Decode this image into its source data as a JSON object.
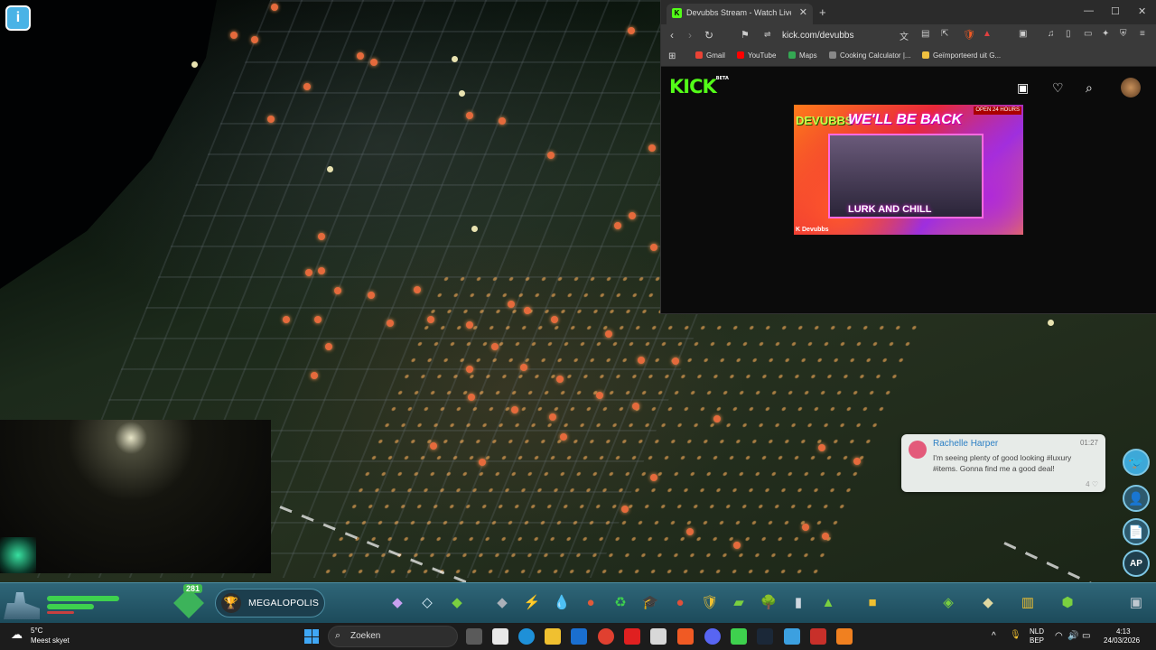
{
  "game": {
    "info_icon": "info-icon",
    "cash_badge": "281",
    "milestone": "MEGALOPOLIS",
    "tool_icons": [
      "zoning",
      "districts",
      "roads",
      "electricity",
      "water",
      "garbage",
      "healthcare",
      "fire",
      "police",
      "education",
      "public-transport",
      "parks",
      "unique-buildings",
      "monuments",
      "areas",
      "bulldozer"
    ]
  },
  "chirp": {
    "author": "Rachelle Harper",
    "time": "01:27",
    "message": "I'm seeing plenty of good looking #luxury #items. Gonna find me a good deal!",
    "likes": "4 ♡"
  },
  "right_panel": {
    "ap_label": "AP"
  },
  "browser": {
    "tab_title": "Devubbs Stream - Watch Live o",
    "url": "kick.com/devubbs",
    "bookmarks": [
      {
        "label": "Gmail",
        "color": "#ea4335"
      },
      {
        "label": "YouTube",
        "color": "#ff0000"
      },
      {
        "label": "Maps",
        "color": "#34a853"
      },
      {
        "label": "Cooking Calculator |...",
        "color": "#888888"
      },
      {
        "label": "Geïmporteerd uit G...",
        "color": "#f0c040"
      }
    ],
    "kick_logo": "KICK",
    "kick_logo_beta": "BETA",
    "stream": {
      "brand": "DEVUBBS",
      "headline": "WE'LL BE BACK",
      "subline": "LURK AND CHILL",
      "open": "OPEN 24 HOURS",
      "handle": "K Devubbs"
    }
  },
  "taskbar": {
    "weather_temp": "5°C",
    "weather_desc": "Meest skyet",
    "search_placeholder": "Zoeken",
    "lang": "NLD",
    "lang2": "BEP",
    "time": "4:13",
    "date": "24/03/2026"
  },
  "colors": {
    "kick_green": "#53fc18",
    "game_bar": "#2f6678",
    "chirp_bg": "#e7ebe8",
    "taskbar": "#1c1c1c"
  }
}
